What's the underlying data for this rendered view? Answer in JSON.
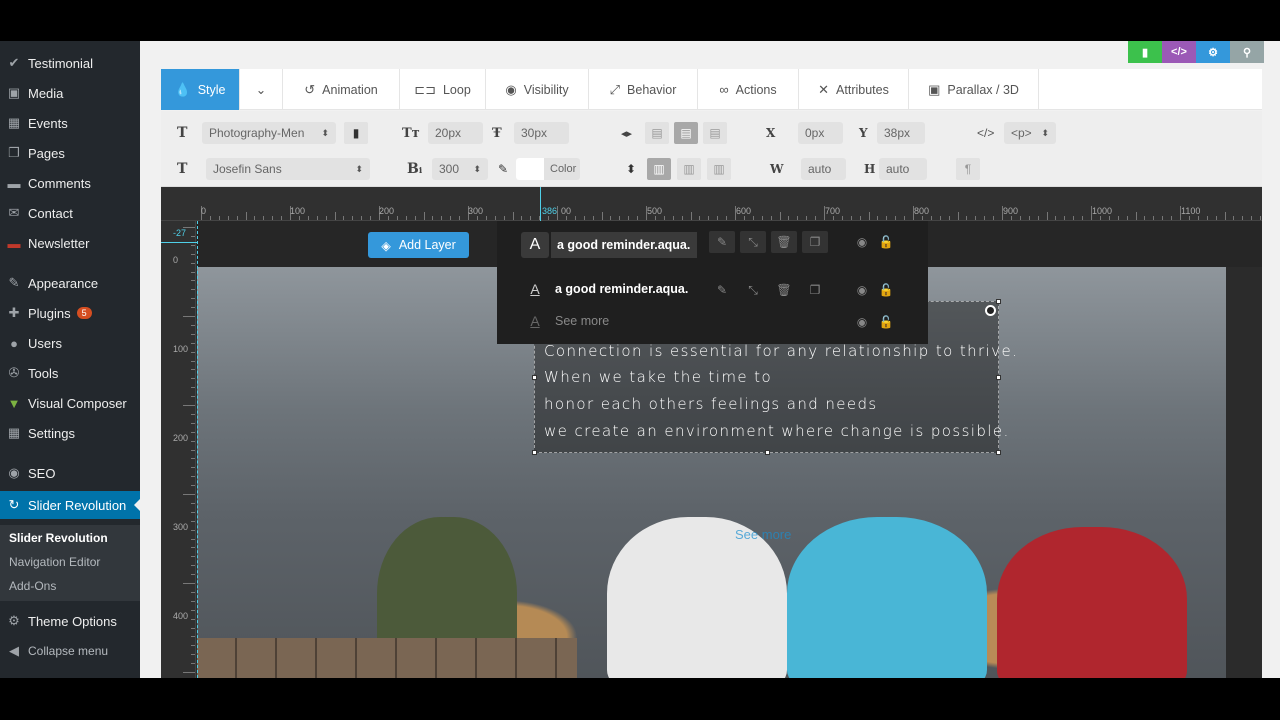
{
  "sidebar": {
    "items": [
      {
        "label": "Testimonial",
        "icon": "check-icon"
      },
      {
        "label": "Media",
        "icon": "media-icon"
      },
      {
        "label": "Events",
        "icon": "calendar-icon"
      },
      {
        "label": "Pages",
        "icon": "pages-icon"
      },
      {
        "label": "Comments",
        "icon": "comment-icon"
      },
      {
        "label": "Contact",
        "icon": "mail-icon"
      },
      {
        "label": "Newsletter",
        "icon": "newsletter-icon"
      },
      {
        "label": "Appearance",
        "icon": "brush-icon"
      },
      {
        "label": "Plugins",
        "icon": "plugin-icon",
        "badge": "5"
      },
      {
        "label": "Users",
        "icon": "user-icon"
      },
      {
        "label": "Tools",
        "icon": "wrench-icon"
      },
      {
        "label": "Visual Composer",
        "icon": "visual-composer-icon"
      },
      {
        "label": "Settings",
        "icon": "settings-icon"
      },
      {
        "label": "SEO",
        "icon": "seo-icon"
      },
      {
        "label": "Slider Revolution",
        "icon": "refresh-icon"
      },
      {
        "label": "Theme Options",
        "icon": "gear-icon"
      },
      {
        "label": "Collapse menu",
        "icon": "collapse-icon"
      }
    ],
    "submenu": [
      "Slider Revolution",
      "Navigation Editor",
      "Add-Ons"
    ]
  },
  "topbuttons": {
    "code": "</>"
  },
  "tabs": [
    "Style",
    "Animation",
    "Loop",
    "Visibility",
    "Behavior",
    "Actions",
    "Attributes",
    "Parallax / 3D"
  ],
  "toolbar": {
    "font_preset": "Photography-Men",
    "font_size": "20px",
    "line_height": "30px",
    "x_label": "X",
    "x_value": "0px",
    "y_label": "Y",
    "y_value": "38px",
    "tag": "<p>",
    "font_family": "Josefin Sans",
    "font_weight": "300",
    "color_label": "Color",
    "w_label": "W",
    "w_value": "auto",
    "h_label": "H",
    "h_value": "auto"
  },
  "ruler": {
    "h_labels": [
      "0",
      "100",
      "200",
      "300",
      "386",
      "00",
      "500",
      "600",
      "700",
      "800",
      "900",
      "1000",
      "1100"
    ],
    "v_labels": [
      "-27",
      "0",
      "100",
      "200",
      "300",
      "400"
    ]
  },
  "editor": {
    "add_layer": "Add Layer",
    "see_more_canvas": "See more",
    "text_lines": [
      "Connection is essential for any relationship to thrive.",
      "When we take the time to",
      "honor each others feelings and needs",
      "we create an environment where change is possible."
    ]
  },
  "popup": {
    "selected_layer": "a good reminder.aqua.",
    "layer2": "a good reminder.aqua.",
    "see_more": "See more"
  },
  "colors": {
    "accent": "#3498db",
    "sidebar": "#23282d",
    "active": "#0073aa"
  }
}
